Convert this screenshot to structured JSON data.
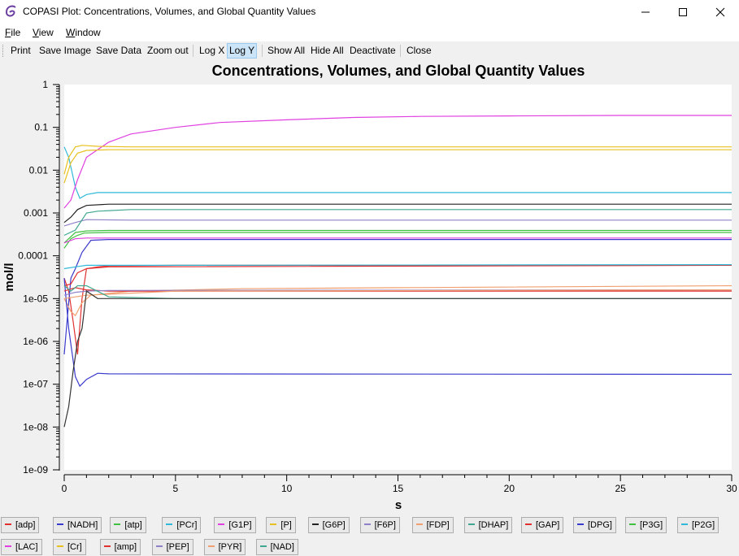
{
  "window": {
    "title": "COPASI Plot: Concentrations, Volumes, and Global Quantity Values",
    "controls": {
      "minimize": "—",
      "maximize": "☐",
      "close": "✕"
    }
  },
  "menu": [
    "File",
    "View",
    "Window"
  ],
  "toolbar": {
    "buttons": [
      "Print",
      "Save Image",
      "Save Data",
      "Zoom out",
      "Log X",
      "Log Y",
      "Show All",
      "Hide All",
      "Deactivate",
      "Close"
    ],
    "active": "Log Y"
  },
  "chart_data": {
    "type": "line",
    "title": "Concentrations, Volumes, and Global Quantity Values",
    "xlabel": "s",
    "ylabel": "mol/l",
    "xlim": [
      0,
      30
    ],
    "ylim": [
      1e-09,
      1
    ],
    "yscale": "log",
    "xticks": [
      "0",
      "5",
      "10",
      "15",
      "20",
      "25",
      "30"
    ],
    "yticks": [
      "1e-09",
      "1e-08",
      "1e-07",
      "1e-06",
      "1e-05",
      "0.0001",
      "0.001",
      "0.01",
      "0.1",
      "1"
    ],
    "grid": false,
    "legend_position": "bottom",
    "series": [
      {
        "name": "[adp]",
        "color": "#e03030",
        "points": [
          [
            0,
            3e-05
          ],
          [
            0.2,
            1.5e-05
          ],
          [
            0.4,
            3e-06
          ],
          [
            0.6,
            5e-07
          ],
          [
            0.8,
            1e-05
          ],
          [
            1,
            5e-05
          ],
          [
            1.5,
            5.5e-05
          ],
          [
            2,
            5.8e-05
          ],
          [
            5,
            6e-05
          ],
          [
            10,
            6e-05
          ],
          [
            20,
            6e-05
          ],
          [
            30,
            6e-05
          ]
        ]
      },
      {
        "name": "[NADH]",
        "color": "#3a3acc",
        "points": [
          [
            0,
            5e-07
          ],
          [
            0.1,
            2e-06
          ],
          [
            0.3,
            3e-05
          ],
          [
            0.5,
            5e-05
          ],
          [
            0.8,
            0.00012
          ],
          [
            1.2,
            0.00023
          ],
          [
            2,
            0.00024
          ],
          [
            10,
            0.00024
          ],
          [
            20,
            0.00024
          ],
          [
            30,
            0.00024
          ]
        ]
      },
      {
        "name": "[atp]",
        "color": "#40c040",
        "points": [
          [
            0,
            0.00015
          ],
          [
            0.3,
            0.00025
          ],
          [
            0.6,
            0.0003
          ],
          [
            0.9,
            0.00034
          ],
          [
            2,
            0.00035
          ],
          [
            30,
            0.00035
          ]
        ]
      },
      {
        "name": "[PCr]",
        "color": "#30b8d8",
        "points": [
          [
            0,
            0.035
          ],
          [
            0.2,
            0.02
          ],
          [
            0.5,
            0.004
          ],
          [
            0.7,
            0.0022
          ],
          [
            1,
            0.0027
          ],
          [
            1.5,
            0.003
          ],
          [
            2,
            0.003
          ],
          [
            30,
            0.003
          ]
        ]
      },
      {
        "name": "[G1P]",
        "color": "#e040e0",
        "points": [
          [
            0,
            0.0013
          ],
          [
            0.3,
            0.002
          ],
          [
            0.6,
            0.006
          ],
          [
            1,
            0.02
          ],
          [
            2,
            0.045
          ],
          [
            3,
            0.07
          ],
          [
            5,
            0.1
          ],
          [
            7,
            0.13
          ],
          [
            10,
            0.15
          ],
          [
            13,
            0.17
          ],
          [
            16,
            0.18
          ],
          [
            20,
            0.185
          ],
          [
            25,
            0.19
          ],
          [
            30,
            0.19
          ]
        ]
      },
      {
        "name": "[P]",
        "color": "#e8c020",
        "points": [
          [
            0,
            0.008
          ],
          [
            0.2,
            0.02
          ],
          [
            0.5,
            0.035
          ],
          [
            0.8,
            0.038
          ],
          [
            1.5,
            0.036
          ],
          [
            3,
            0.035
          ],
          [
            30,
            0.035
          ]
        ]
      },
      {
        "name": "[G6P]",
        "color": "#222222",
        "points": [
          [
            0,
            0.0006
          ],
          [
            0.3,
            0.0008
          ],
          [
            0.6,
            0.0012
          ],
          [
            1,
            0.0015
          ],
          [
            2,
            0.0016
          ],
          [
            30,
            0.0016
          ]
        ]
      },
      {
        "name": "[F6P]",
        "color": "#9080c8",
        "points": [
          [
            0,
            0.0005
          ],
          [
            0.5,
            0.0006
          ],
          [
            1,
            0.0007
          ],
          [
            3,
            0.00068
          ],
          [
            30,
            0.00068
          ]
        ]
      },
      {
        "name": "[FDP]",
        "color": "#f0a070",
        "points": [
          [
            0,
            1e-05
          ],
          [
            0.3,
            5e-06
          ],
          [
            0.5,
            4e-06
          ],
          [
            0.8,
            8e-06
          ],
          [
            1.2,
            1.2e-05
          ],
          [
            3,
            1.5e-05
          ],
          [
            8,
            1.7e-05
          ],
          [
            15,
            1.8e-05
          ],
          [
            30,
            2e-05
          ]
        ]
      },
      {
        "name": "[DHAP]",
        "color": "#40a890",
        "points": [
          [
            0,
            0.0003
          ],
          [
            0.5,
            0.0004
          ],
          [
            1,
            0.001
          ],
          [
            1.5,
            0.0011
          ],
          [
            3,
            0.0012
          ],
          [
            30,
            0.0012
          ]
        ]
      },
      {
        "name": "[GAP]",
        "color": "#e03030",
        "points": [
          [
            0,
            2e-05
          ],
          [
            0.3,
            2.2e-05
          ],
          [
            0.6,
            4e-05
          ],
          [
            1,
            5e-05
          ],
          [
            2,
            5.5e-05
          ],
          [
            30,
            6e-05
          ]
        ]
      },
      {
        "name": "[DPG]",
        "color": "#3a3acc",
        "points": [
          [
            0,
            3e-05
          ],
          [
            0.2,
            2e-06
          ],
          [
            0.5,
            1.5e-07
          ],
          [
            0.7,
            9e-08
          ],
          [
            1,
            1.3e-07
          ],
          [
            1.5,
            1.8e-07
          ],
          [
            2,
            1.75e-07
          ],
          [
            30,
            1.7e-07
          ]
        ]
      },
      {
        "name": "[P3G]",
        "color": "#40c040",
        "points": [
          [
            0,
            0.0002
          ],
          [
            0.5,
            0.00035
          ],
          [
            1,
            0.00038
          ],
          [
            2,
            0.00039
          ],
          [
            30,
            0.00039
          ]
        ]
      },
      {
        "name": "[P2G]",
        "color": "#30b8d8",
        "points": [
          [
            0,
            5e-05
          ],
          [
            0.5,
            5.5e-05
          ],
          [
            1,
            6e-05
          ],
          [
            5,
            6e-05
          ],
          [
            30,
            6.2e-05
          ]
        ]
      },
      {
        "name": "[LAC]",
        "color": "#e040e0",
        "points": [
          [
            0,
            0.0002
          ],
          [
            0.5,
            0.00025
          ],
          [
            1,
            0.00026
          ],
          [
            30,
            0.00026
          ]
        ]
      },
      {
        "name": "[Cr]",
        "color": "#e8c020",
        "points": [
          [
            0,
            0.005
          ],
          [
            0.3,
            0.015
          ],
          [
            0.6,
            0.025
          ],
          [
            1,
            0.029
          ],
          [
            2,
            0.03
          ],
          [
            30,
            0.03
          ]
        ]
      },
      {
        "name": "[amp]",
        "color": "#e03030",
        "points": [
          [
            0,
            1.5e-05
          ],
          [
            0.5,
            1.8e-05
          ],
          [
            1,
            1.6e-05
          ],
          [
            2,
            1.5e-05
          ],
          [
            30,
            1.5e-05
          ]
        ]
      },
      {
        "name": "[PEP]",
        "color": "#9080c8",
        "points": [
          [
            0,
            1.2e-05
          ],
          [
            0.5,
            1.4e-05
          ],
          [
            1,
            1.5e-05
          ],
          [
            2,
            1.55e-05
          ],
          [
            30,
            1.6e-05
          ]
        ]
      },
      {
        "name": "[PYR]",
        "color": "#f0a070",
        "points": [
          [
            0,
            1e-05
          ],
          [
            0.5,
            1.1e-05
          ],
          [
            1,
            1.2e-05
          ],
          [
            5,
            1.5e-05
          ],
          [
            30,
            1.6e-05
          ]
        ]
      },
      {
        "name": "[NAD]",
        "color": "#40a890",
        "points": [
          [
            0,
            2e-05
          ],
          [
            0.3,
            1.5e-05
          ],
          [
            0.6,
            2e-05
          ],
          [
            1,
            2e-05
          ],
          [
            2,
            1.1e-05
          ],
          [
            5,
            1e-05
          ],
          [
            30,
            1e-05
          ]
        ]
      },
      {
        "name": "",
        "color": "#333333",
        "points": [
          [
            0,
            1e-08
          ],
          [
            0.2,
            3e-08
          ],
          [
            0.4,
            2e-07
          ],
          [
            0.6,
            1e-06
          ],
          [
            0.8,
            2e-06
          ],
          [
            1,
            1.5e-05
          ],
          [
            1.5,
            1e-05
          ],
          [
            30,
            1e-05
          ]
        ]
      }
    ]
  }
}
